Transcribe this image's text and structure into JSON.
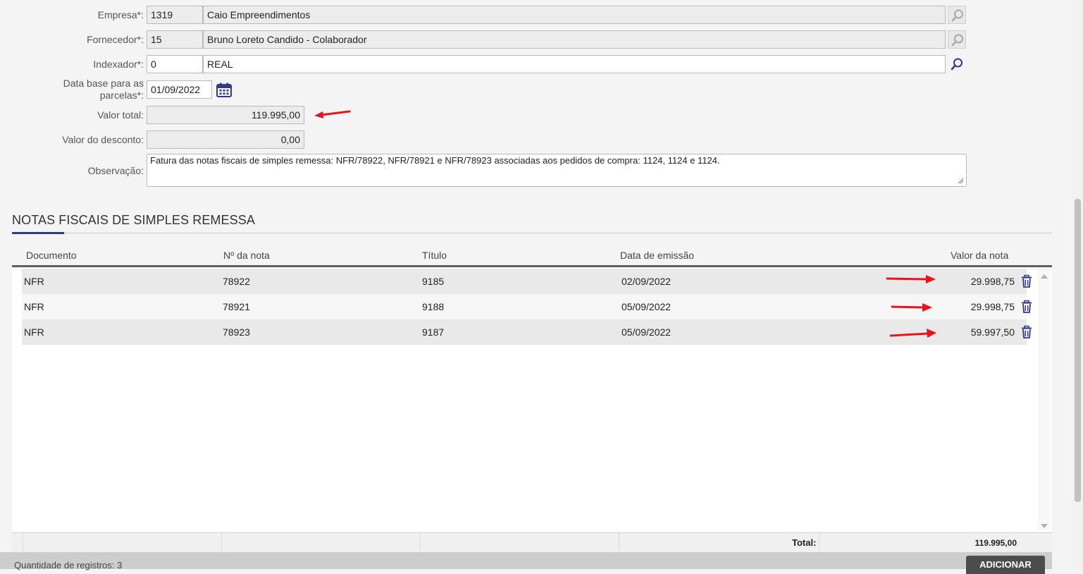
{
  "form": {
    "empresa": {
      "label": "Empresa*:",
      "code": "1319",
      "name": "Caio Empreendimentos"
    },
    "fornecedor": {
      "label": "Fornecedor*:",
      "code": "15",
      "name": "Bruno Loreto Candido - Colaborador"
    },
    "indexador": {
      "label": "Indexador*:",
      "code": "0",
      "name": "REAL"
    },
    "data_base": {
      "label_line1": "Data base para as",
      "label_line2": "parcelas*:",
      "value": "01/09/2022"
    },
    "valor_total": {
      "label": "Valor total:",
      "value": "119.995,00"
    },
    "valor_desconto": {
      "label": "Valor do desconto:",
      "value": "0,00"
    },
    "observacao": {
      "label": "Observação:",
      "value": "Fatura das notas fiscais de simples remessa: NFR/78922, NFR/78921 e NFR/78923 associadas aos pedidos de compra: 1124, 1124 e 1124."
    }
  },
  "section": {
    "title": "NOTAS FISCAIS DE SIMPLES REMESSA"
  },
  "table": {
    "headers": [
      "Documento",
      "Nº da nota",
      "Título",
      "Data de emissão",
      "Valor da nota"
    ],
    "rows": [
      {
        "documento": "NFR",
        "numero": "78922",
        "titulo": "9185",
        "data": "02/09/2022",
        "valor": "29.998,75"
      },
      {
        "documento": "NFR",
        "numero": "78921",
        "titulo": "9188",
        "data": "05/09/2022",
        "valor": "29.998,75"
      },
      {
        "documento": "NFR",
        "numero": "78923",
        "titulo": "9187",
        "data": "05/09/2022",
        "valor": "59.997,50"
      }
    ],
    "total_label": "Total:",
    "total_value": "119.995,00"
  },
  "footer": {
    "count_text": "Quantidade de registros: 3",
    "add_button": "ADICIONAR"
  },
  "colors": {
    "accent": "#2e3a8c",
    "annotation_arrow": "#e8141a",
    "icon": "#2e3a8c"
  }
}
